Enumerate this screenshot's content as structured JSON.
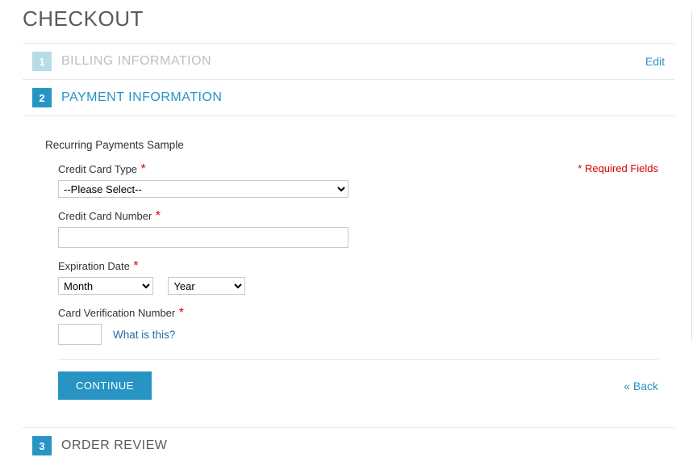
{
  "page_title": "CHECKOUT",
  "steps": {
    "s1": {
      "num": "1",
      "title": "BILLING INFORMATION",
      "edit": "Edit"
    },
    "s2": {
      "num": "2",
      "title": "PAYMENT INFORMATION"
    },
    "s3": {
      "num": "3",
      "title": "ORDER REVIEW"
    }
  },
  "panel": {
    "recurring_title": "Recurring Payments Sample",
    "required_note": "* Required Fields",
    "labels": {
      "cc_type": "Credit Card Type",
      "cc_number": "Credit Card Number",
      "exp_date": "Expiration Date",
      "cvv": "Card Verification Number"
    },
    "placeholders": {
      "cc_type": "--Please Select--",
      "month": "Month",
      "year": "Year"
    },
    "values": {
      "cc_number": "",
      "cvv": ""
    },
    "what_is_this": "What is this?",
    "continue": "CONTINUE",
    "back": "« Back"
  },
  "star": "*"
}
